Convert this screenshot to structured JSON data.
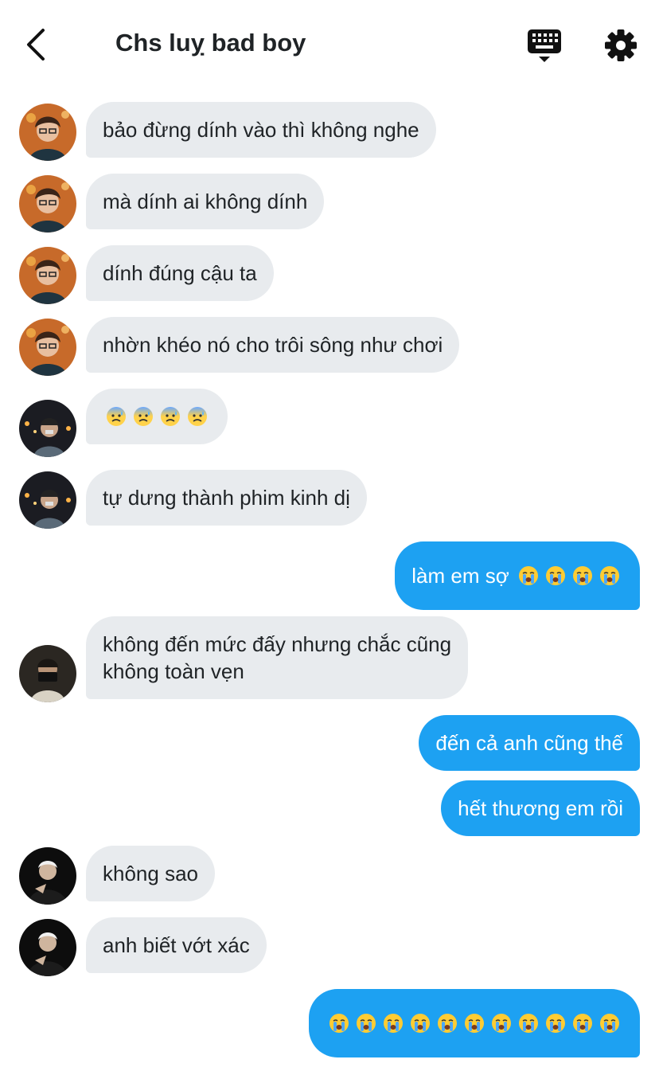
{
  "header": {
    "title": "Chs luỵ bad boy",
    "back_icon": "chevron-left-icon",
    "keyboard_icon": "keyboard-icon",
    "settings_icon": "gear-icon"
  },
  "colors": {
    "accent": "#1da1f2",
    "incoming_bubble": "#e8ebee",
    "text": "#1f2326"
  },
  "messages": [
    {
      "direction": "in",
      "text": "bảo đừng dính vào thì không nghe"
    },
    {
      "direction": "in",
      "text": "mà dính ai không dính"
    },
    {
      "direction": "in",
      "text": "dính đúng cậu ta"
    },
    {
      "direction": "in",
      "text": "nhờn khéo nó cho trôi sông như chơi"
    },
    {
      "direction": "in",
      "text": "😰😰😰😰"
    },
    {
      "direction": "in",
      "text": "tự dưng thành phim kinh dị"
    },
    {
      "direction": "out",
      "text": "làm em sợ 😭😭😭😭"
    },
    {
      "direction": "in",
      "text": "không đến mức đấy nhưng chắc cũng\nkhông toàn vẹn"
    },
    {
      "direction": "out",
      "text": "đến cả anh cũng thế"
    },
    {
      "direction": "out",
      "text": "hết thương em rồi"
    },
    {
      "direction": "in",
      "text": "không sao"
    },
    {
      "direction": "in",
      "text": "anh biết vớt xác"
    },
    {
      "direction": "out",
      "text": "😭😭😭😭😭😭😭😭😭😭😭"
    }
  ]
}
